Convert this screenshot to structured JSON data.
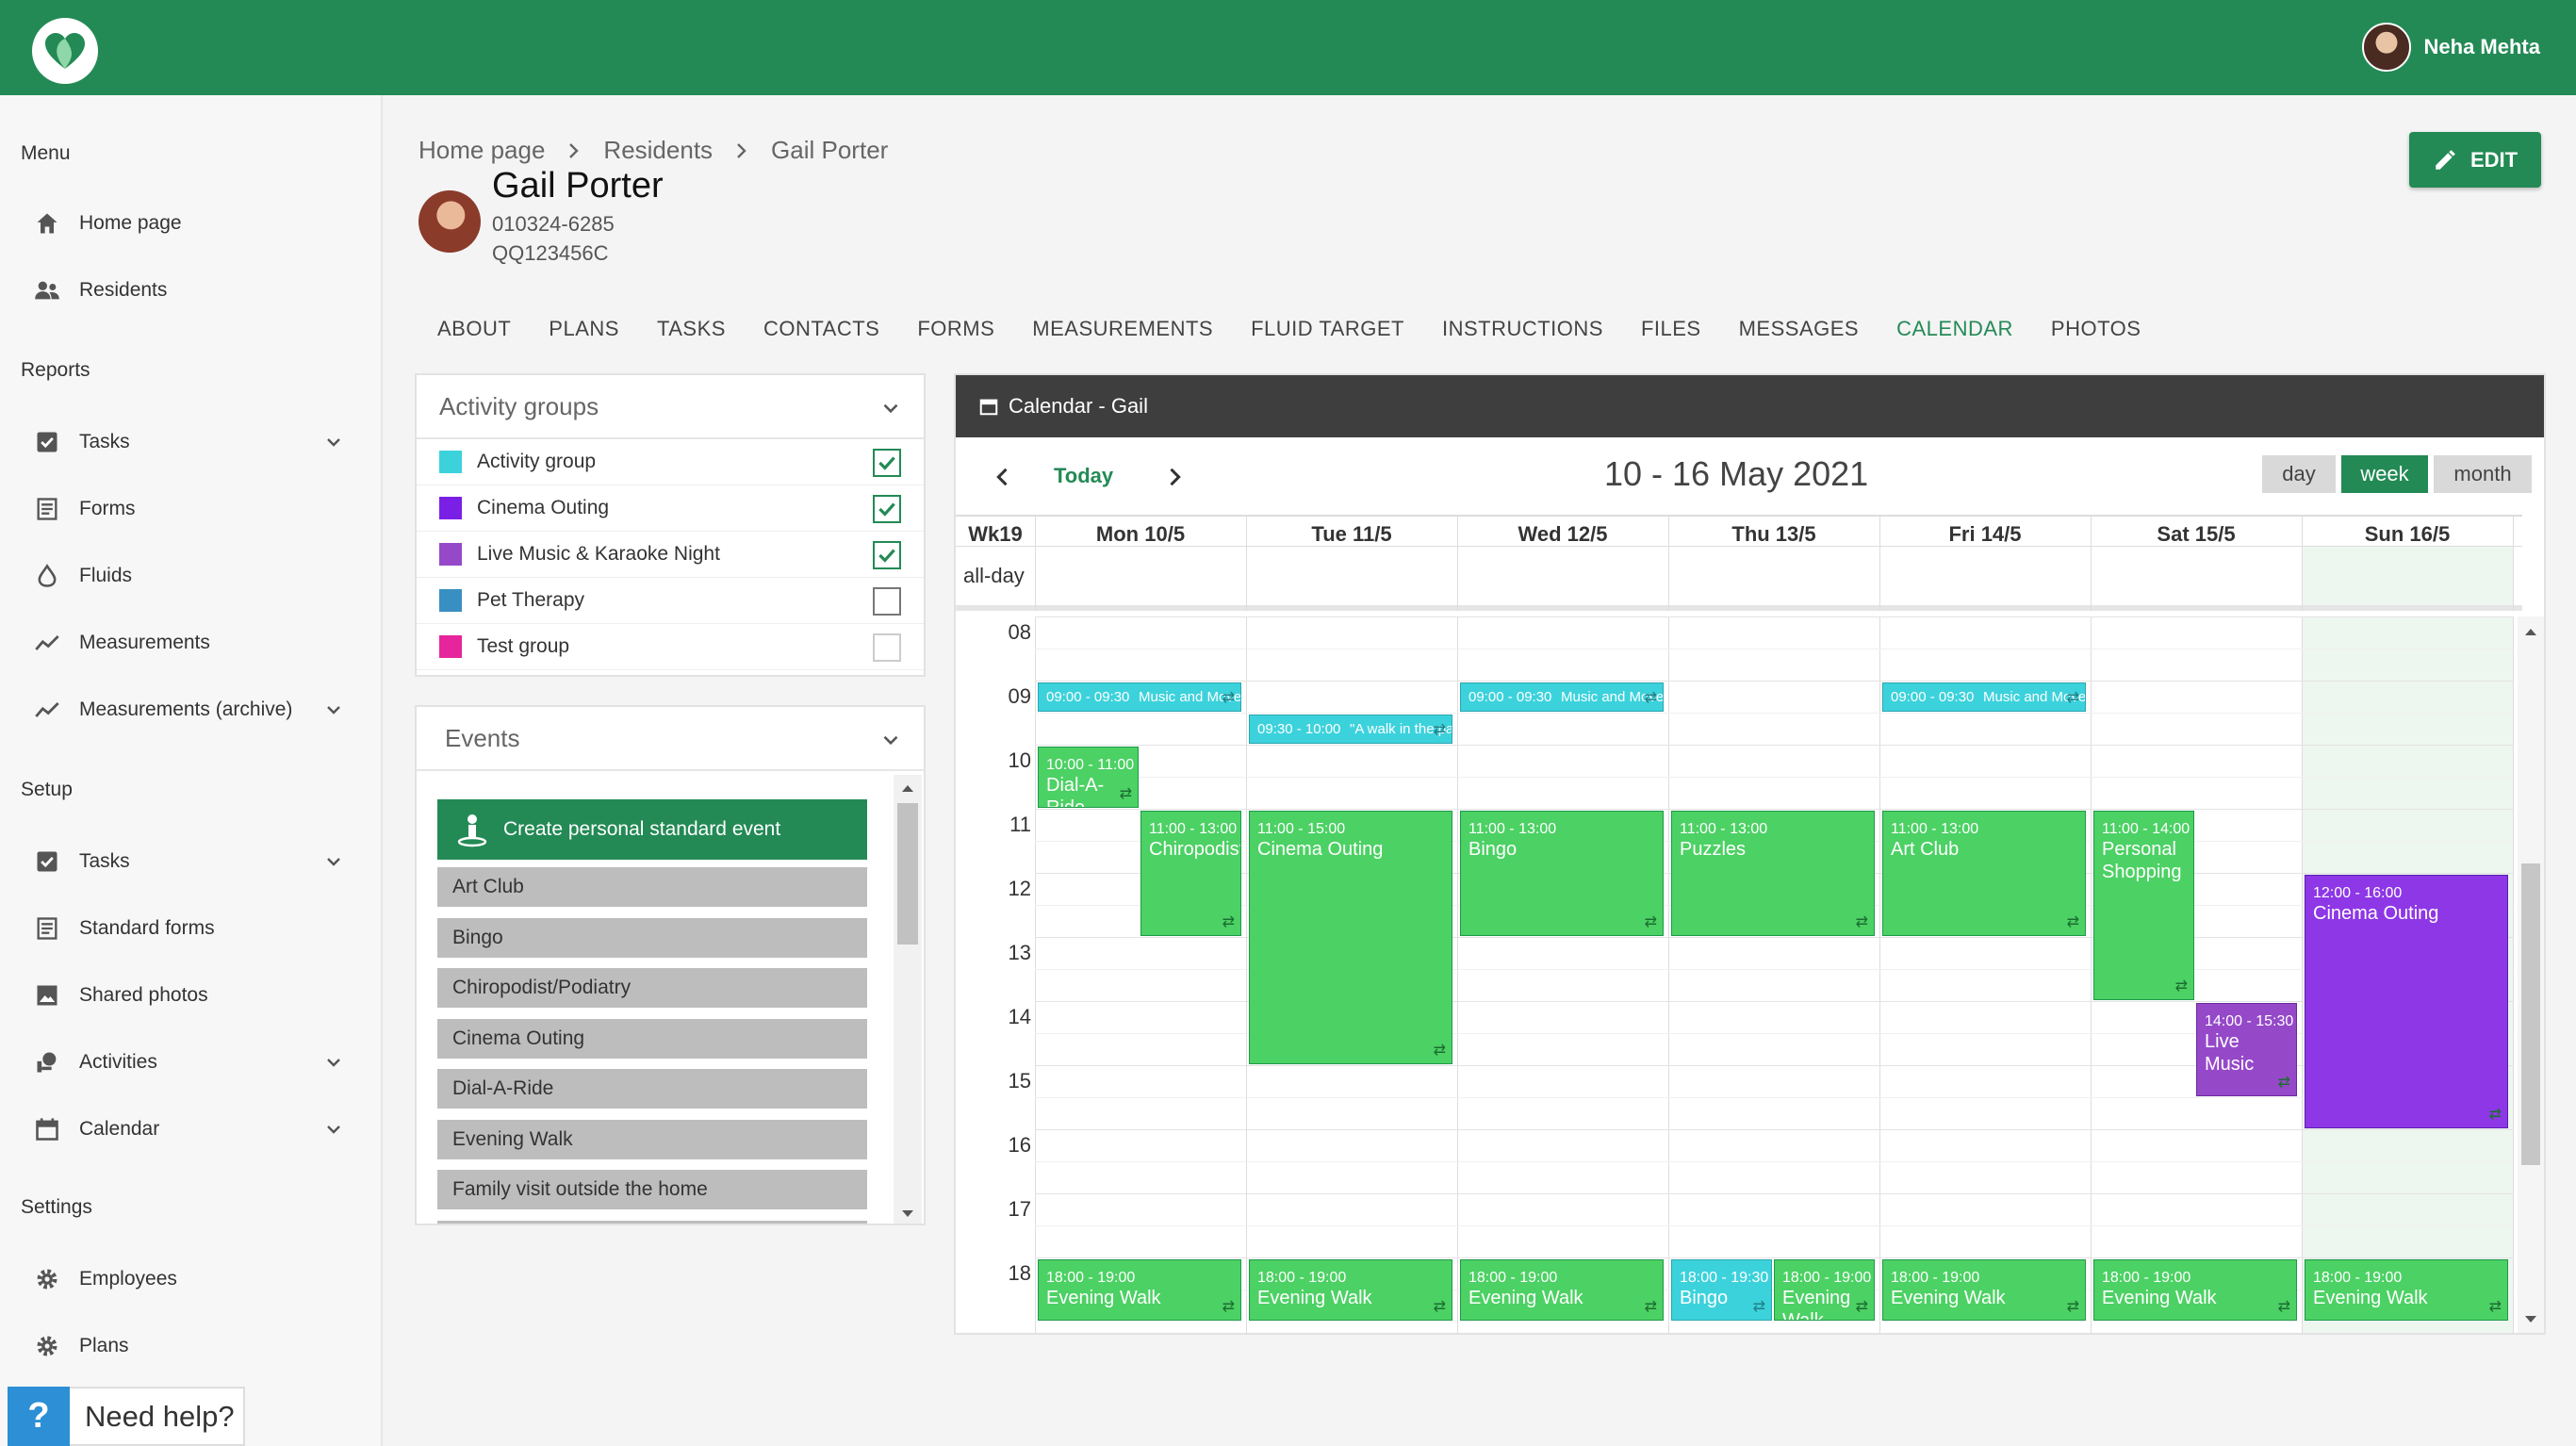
{
  "header": {
    "user_name": "Neha Mehta"
  },
  "sidebar": {
    "menu_title": "Menu",
    "menu_items": [
      {
        "label": "Home page"
      },
      {
        "label": "Residents"
      }
    ],
    "reports_title": "Reports",
    "reports_items": [
      {
        "label": "Tasks"
      },
      {
        "label": "Forms"
      },
      {
        "label": "Fluids"
      },
      {
        "label": "Measurements"
      },
      {
        "label": "Measurements (archive)"
      }
    ],
    "setup_title": "Setup",
    "setup_items": [
      {
        "label": "Tasks"
      },
      {
        "label": "Standard forms"
      },
      {
        "label": "Shared photos"
      },
      {
        "label": "Activities"
      },
      {
        "label": "Calendar"
      }
    ],
    "settings_title": "Settings",
    "settings_items": [
      {
        "label": "Employees"
      },
      {
        "label": "Plans"
      }
    ],
    "help_label": "Need help?",
    "help_icon": "?"
  },
  "breadcrumb": [
    "Home page",
    "Residents",
    "Gail Porter"
  ],
  "resident": {
    "name": "Gail Porter",
    "id1": "010324-6285",
    "id2": "QQ123456C"
  },
  "edit_label": "EDIT",
  "tabs": [
    "ABOUT",
    "PLANS",
    "TASKS",
    "CONTACTS",
    "FORMS",
    "MEASUREMENTS",
    "FLUID TARGET",
    "INSTRUCTIONS",
    "FILES",
    "MESSAGES",
    "CALENDAR",
    "PHOTOS"
  ],
  "activity_groups": {
    "title": "Activity groups",
    "items": [
      {
        "label": "Activity group",
        "color": "#3cd2dc",
        "checked": true
      },
      {
        "label": "Cinema Outing",
        "color": "#7a1fe6",
        "checked": true
      },
      {
        "label": "Live Music & Karaoke Night",
        "color": "#9549c9",
        "checked": true
      },
      {
        "label": "Pet Therapy",
        "color": "#3a8fc2",
        "checked": false
      },
      {
        "label": "Test group",
        "color": "#e6249b",
        "checked": false
      }
    ]
  },
  "events_panel": {
    "title": "Events",
    "create_label": "Create personal standard event",
    "items": [
      "Art Club",
      "Bingo",
      "Chiropodist/Podiatry",
      "Cinema Outing",
      "Dial-A-Ride",
      "Evening Walk",
      "Family visit outside the home"
    ]
  },
  "calendar": {
    "title": "Calendar - Gail",
    "today_label": "Today",
    "range": "10 - 16 May 2021",
    "views": [
      "day",
      "week",
      "month"
    ],
    "active_view": "week",
    "week_label": "Wk19",
    "allday_label": "all-day",
    "days": [
      "Mon 10/5",
      "Tue 11/5",
      "Wed 12/5",
      "Thu 13/5",
      "Fri 14/5",
      "Sat 15/5",
      "Sun 16/5"
    ],
    "hours": [
      "08",
      "09",
      "10",
      "11",
      "12",
      "13",
      "14",
      "15",
      "16",
      "17",
      "18"
    ],
    "events": [
      {
        "day": 0,
        "start": 9.0,
        "end": 9.5,
        "time": "09:00 - 09:30",
        "title": "Music and Movement",
        "color": "cyan",
        "inline": true
      },
      {
        "day": 2,
        "start": 9.0,
        "end": 9.5,
        "time": "09:00 - 09:30",
        "title": "Music and Movement",
        "color": "cyan",
        "inline": true
      },
      {
        "day": 4,
        "start": 9.0,
        "end": 9.5,
        "time": "09:00 - 09:30",
        "title": "Music and Movement",
        "color": "cyan",
        "inline": true
      },
      {
        "day": 1,
        "start": 9.5,
        "end": 10.0,
        "time": "09:30 - 10:00",
        "title": "\"A walk in the park\"",
        "color": "cyan",
        "inline": true
      },
      {
        "day": 0,
        "start": 10.0,
        "end": 11.0,
        "time": "10:00 - 11:00",
        "title": "Dial-A-Ride",
        "color": "green",
        "col": 0,
        "cols": 2
      },
      {
        "day": 0,
        "start": 11.0,
        "end": 13.0,
        "time": "11:00 - 13:00",
        "title": "Chiropodist/Podiatry",
        "color": "green",
        "col": 1,
        "cols": 2
      },
      {
        "day": 1,
        "start": 11.0,
        "end": 15.0,
        "time": "11:00 - 15:00",
        "title": "Cinema Outing",
        "color": "green"
      },
      {
        "day": 2,
        "start": 11.0,
        "end": 13.0,
        "time": "11:00 - 13:00",
        "title": "Bingo",
        "color": "green"
      },
      {
        "day": 3,
        "start": 11.0,
        "end": 13.0,
        "time": "11:00 - 13:00",
        "title": "Puzzles",
        "color": "green"
      },
      {
        "day": 4,
        "start": 11.0,
        "end": 13.0,
        "time": "11:00 - 13:00",
        "title": "Art Club",
        "color": "green"
      },
      {
        "day": 5,
        "start": 11.0,
        "end": 14.0,
        "time": "11:00 - 14:00",
        "title": "Personal Shopping",
        "color": "green",
        "col": 0,
        "cols": 2
      },
      {
        "day": 5,
        "start": 14.0,
        "end": 15.5,
        "time": "14:00 - 15:30",
        "title": "Live Music",
        "color": "purple",
        "col": 1,
        "cols": 2
      },
      {
        "day": 6,
        "start": 12.0,
        "end": 16.0,
        "time": "12:00 - 16:00",
        "title": "Cinema Outing",
        "color": "sunpurple"
      },
      {
        "day": 0,
        "start": 18.0,
        "end": 19.0,
        "time": "18:00 - 19:00",
        "title": "Evening Walk",
        "color": "green"
      },
      {
        "day": 1,
        "start": 18.0,
        "end": 19.0,
        "time": "18:00 - 19:00",
        "title": "Evening Walk",
        "color": "green"
      },
      {
        "day": 2,
        "start": 18.0,
        "end": 19.0,
        "time": "18:00 - 19:00",
        "title": "Evening Walk",
        "color": "green"
      },
      {
        "day": 3,
        "start": 18.0,
        "end": 19.0,
        "time": "18:00 - 19:30",
        "title": "Bingo",
        "color": "cyan",
        "col": 0,
        "cols": 2
      },
      {
        "day": 3,
        "start": 18.0,
        "end": 19.0,
        "time": "18:00 - 19:00",
        "title": "Evening Walk",
        "color": "green",
        "col": 1,
        "cols": 2
      },
      {
        "day": 4,
        "start": 18.0,
        "end": 19.0,
        "time": "18:00 - 19:00",
        "title": "Evening Walk",
        "color": "green"
      },
      {
        "day": 5,
        "start": 18.0,
        "end": 19.0,
        "time": "18:00 - 19:00",
        "title": "Evening Walk",
        "color": "green"
      },
      {
        "day": 6,
        "start": 18.0,
        "end": 19.0,
        "time": "18:00 - 19:00",
        "title": "Evening Walk",
        "color": "green"
      }
    ]
  }
}
